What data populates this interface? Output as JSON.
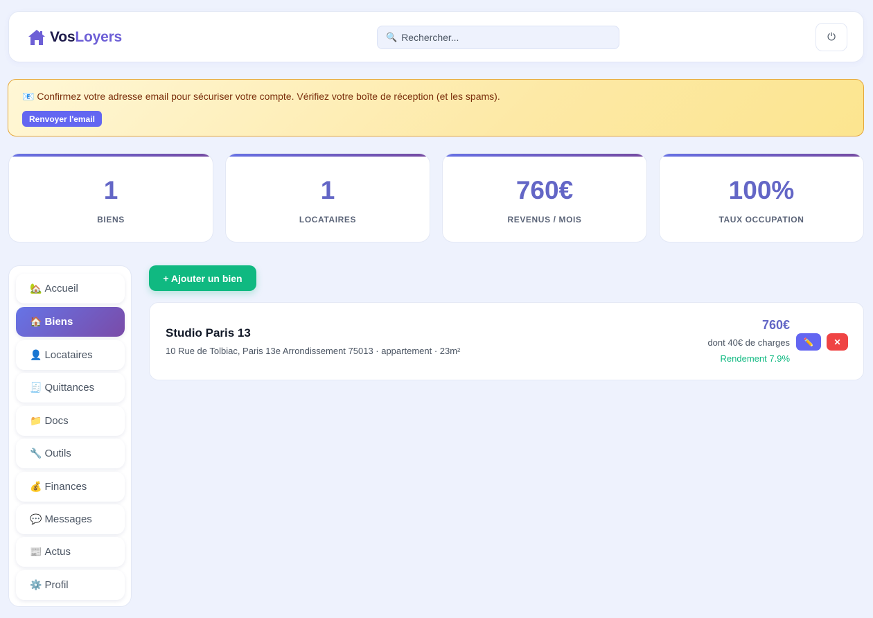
{
  "header": {
    "logo_part1": "Vos",
    "logo_part2": "Loyers",
    "logo_icon": "house-icon",
    "search_placeholder": "Rechercher...",
    "search_icon": "🔍",
    "power_icon": "⏻"
  },
  "alert": {
    "icon": "📧",
    "message": "Confirmez votre adresse email pour sécuriser votre compte. Vérifiez votre boîte de réception (et les spams).",
    "button_label": "Renvoyer l'email"
  },
  "stats": [
    {
      "value": "1",
      "label": "BIENS"
    },
    {
      "value": "1",
      "label": "LOCATAIRES"
    },
    {
      "value": "760€",
      "label": "REVENUS / MOIS"
    },
    {
      "value": "100%",
      "label": "TAUX OCCUPATION"
    }
  ],
  "sidebar": {
    "items": [
      {
        "emoji": "🏡",
        "label": "Accueil"
      },
      {
        "emoji": "🏠",
        "label": "Biens",
        "active": true
      },
      {
        "emoji": "👤",
        "label": "Locataires"
      },
      {
        "emoji": "🧾",
        "label": "Quittances"
      },
      {
        "emoji": "📁",
        "label": "Docs"
      },
      {
        "emoji": "🔧",
        "label": "Outils"
      },
      {
        "emoji": "💰",
        "label": "Finances"
      },
      {
        "emoji": "💬",
        "label": "Messages"
      },
      {
        "emoji": "📰",
        "label": "Actus"
      },
      {
        "emoji": "⚙️",
        "label": "Profil"
      }
    ]
  },
  "main": {
    "add_button_label": "+ Ajouter un bien",
    "property": {
      "title": "Studio Paris 13",
      "address": "10 Rue de Tolbiac, Paris 13e Arrondissement 75013 · appartement · 23m²",
      "rent": "760€",
      "charges": "dont 40€ de charges",
      "yield": "Rendement 7.9%",
      "edit_icon": "✏️",
      "delete_icon": "✕"
    }
  },
  "colors": {
    "accent": "#6366f1",
    "success": "#10b981",
    "danger": "#ef4444",
    "stat_value": "#6366c6"
  }
}
